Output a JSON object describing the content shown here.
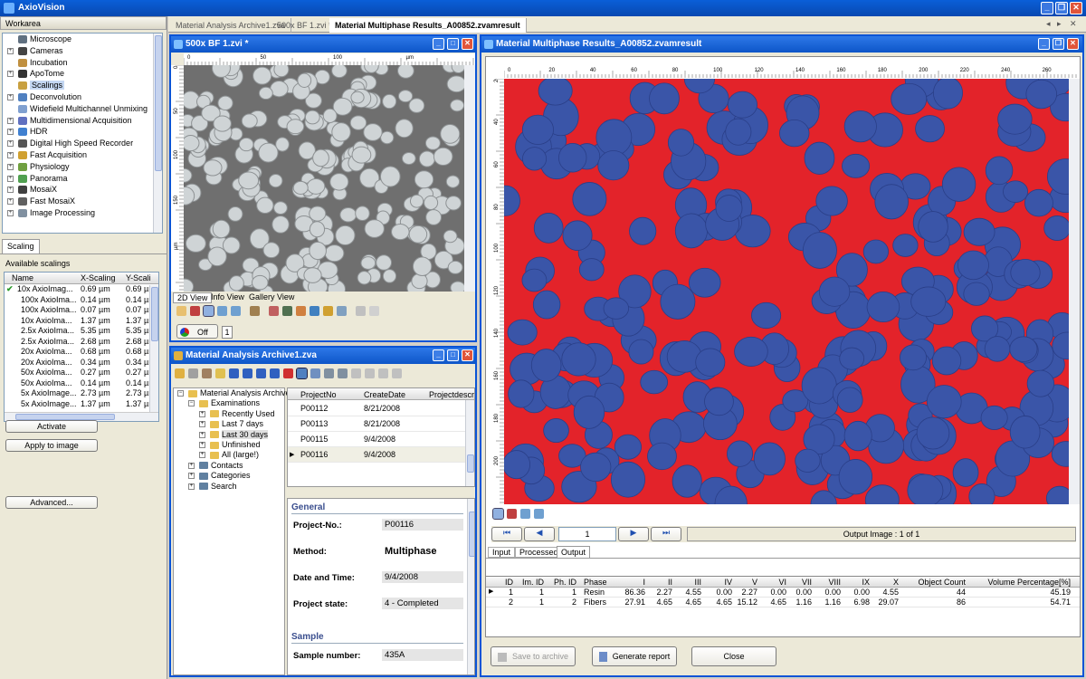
{
  "app": {
    "title": "AxioVision"
  },
  "workarea": {
    "header": "Workarea",
    "items": [
      {
        "label": "Microscope",
        "color": "#607080"
      },
      {
        "label": "Cameras",
        "color": "#444"
      },
      {
        "label": "Incubation",
        "color": "#c09040"
      },
      {
        "label": "ApoTome",
        "color": "#333"
      },
      {
        "label": "Scalings",
        "color": "#c8a040"
      },
      {
        "label": "Deconvolution",
        "color": "#5080c0"
      },
      {
        "label": "Widefield Multichannel Unmixing",
        "color": "#80a0d0"
      },
      {
        "label": "Multidimensional Acquisition",
        "color": "#6070c0"
      },
      {
        "label": "HDR",
        "color": "#4080d0"
      },
      {
        "label": "Digital High Speed Recorder",
        "color": "#555"
      },
      {
        "label": "Fast Acquisition",
        "color": "#d0a030"
      },
      {
        "label": "Physiology",
        "color": "#70a040"
      },
      {
        "label": "Panorama",
        "color": "#50a050"
      },
      {
        "label": "MosaiX",
        "color": "#404040"
      },
      {
        "label": "Fast MosaiX",
        "color": "#606060"
      },
      {
        "label": "Image Processing",
        "color": "#8090a0"
      }
    ]
  },
  "scaling": {
    "tab": "Scaling",
    "available": "Available scalings",
    "cols": [
      "Name",
      "X-Scaling",
      "Y-Scali"
    ],
    "rows": [
      [
        "10x AxioImag...",
        "0.69 µm",
        "0.69 µr"
      ],
      [
        "100x AxioIma...",
        "0.14 µm",
        "0.14 µr"
      ],
      [
        "100x AxioIma...",
        "0.07 µm",
        "0.07 µr"
      ],
      [
        "10x AxioIma...",
        "1.37 µm",
        "1.37 µr"
      ],
      [
        "2.5x AxioIma...",
        "5.35 µm",
        "5.35 µr"
      ],
      [
        "2.5x AxioIma...",
        "2.68 µm",
        "2.68 µr"
      ],
      [
        "20x AxioIma...",
        "0.68 µm",
        "0.68 µr"
      ],
      [
        "20x AxioIma...",
        "0.34 µm",
        "0.34 µr"
      ],
      [
        "50x AxioIma...",
        "0.27 µm",
        "0.27 µr"
      ],
      [
        "50x AxioIma...",
        "0.14 µm",
        "0.14 µr"
      ],
      [
        "5x AxioImage...",
        "2.73 µm",
        "2.73 µr"
      ],
      [
        "5x AxioImage...",
        "1.37 µm",
        "1.37 µr"
      ]
    ],
    "activate": "Activate",
    "apply": "Apply to image",
    "advanced": "Advanced..."
  },
  "tabs": [
    "Material Analysis Archive1.zva",
    "500x BF 1.zvi *",
    "Material Multiphase Results_A00852.zvamresult"
  ],
  "imgwin": {
    "title": "500x BF 1.zvi *",
    "rulerTop": [
      "0",
      "50",
      "100",
      "µm"
    ],
    "rulerLeft": [
      "0",
      "50",
      "100",
      "150",
      "µm"
    ],
    "viewtabs": [
      "2D View",
      "Info View",
      "Gallery View"
    ],
    "off": "Off",
    "page": "1"
  },
  "archive": {
    "title": "Material Analysis Archive1.zva",
    "tree": [
      {
        "label": "Material Analysis Archive1",
        "level": 0
      },
      {
        "label": "Examinations",
        "level": 1
      },
      {
        "label": "Recently Used",
        "level": 2
      },
      {
        "label": "Last 7 days",
        "level": 2
      },
      {
        "label": "Last 30 days",
        "level": 2
      },
      {
        "label": "Unfinished",
        "level": 2
      },
      {
        "label": "All (large!)",
        "level": 2
      },
      {
        "label": "Contacts",
        "level": 1
      },
      {
        "label": "Categories",
        "level": 1
      },
      {
        "label": "Search",
        "level": 1
      }
    ],
    "gridcols": [
      "ProjectNo",
      "CreateDate",
      "Projectdescript"
    ],
    "gridrows": [
      [
        "P00112",
        "8/21/2008"
      ],
      [
        "P00113",
        "8/21/2008"
      ],
      [
        "P00115",
        "9/4/2008"
      ],
      [
        "P00116",
        "9/4/2008"
      ]
    ],
    "general": "General",
    "props": [
      {
        "k": "Project-No.:",
        "v": "P00116"
      },
      {
        "k": "Method:",
        "v": "Multiphase"
      },
      {
        "k": "Date and Time:",
        "v": "9/4/2008"
      },
      {
        "k": "Project state:",
        "v": "4 - Completed"
      }
    ],
    "sample": "Sample",
    "sampleno_k": "Sample number:",
    "sampleno_v": "435A"
  },
  "results": {
    "title": "Material Multiphase Results_A00852.zvamresult",
    "rulerTop": [
      "0",
      "20",
      "40",
      "60",
      "80",
      "100",
      "120",
      "140",
      "160",
      "180",
      "200",
      "220",
      "240",
      "260"
    ],
    "rulerLeft": [
      "20",
      "40",
      "60",
      "80",
      "100",
      "120",
      "140",
      "160",
      "180",
      "200"
    ],
    "rulerUnitTop": "µm",
    "rulerUnitLeft": "µm",
    "page": "1",
    "outputLabel": "Output Image : 1 of 1",
    "subtabs": [
      "Input",
      "Processed",
      "Output"
    ],
    "colors": {
      "phase1": "#e3232a",
      "phase2": "#3a55a8"
    },
    "cols": [
      "ID",
      "Im. ID",
      "Ph. ID",
      "Phase",
      "I",
      "II",
      "III",
      "IV",
      "V",
      "VI",
      "VII",
      "VIII",
      "IX",
      "X",
      "Object Count",
      "Volume Percentage[%]"
    ],
    "rows": [
      [
        "1",
        "1",
        "1",
        "Resin",
        "86.36",
        "2.27",
        "4.55",
        "0.00",
        "2.27",
        "0.00",
        "0.00",
        "0.00",
        "0.00",
        "4.55",
        "44",
        "45.19"
      ],
      [
        "2",
        "1",
        "2",
        "Fibers",
        "27.91",
        "4.65",
        "4.65",
        "4.65",
        "15.12",
        "4.65",
        "1.16",
        "1.16",
        "6.98",
        "29.07",
        "86",
        "54.71"
      ]
    ],
    "save": "Save to archive",
    "report": "Generate report",
    "close": "Close"
  }
}
